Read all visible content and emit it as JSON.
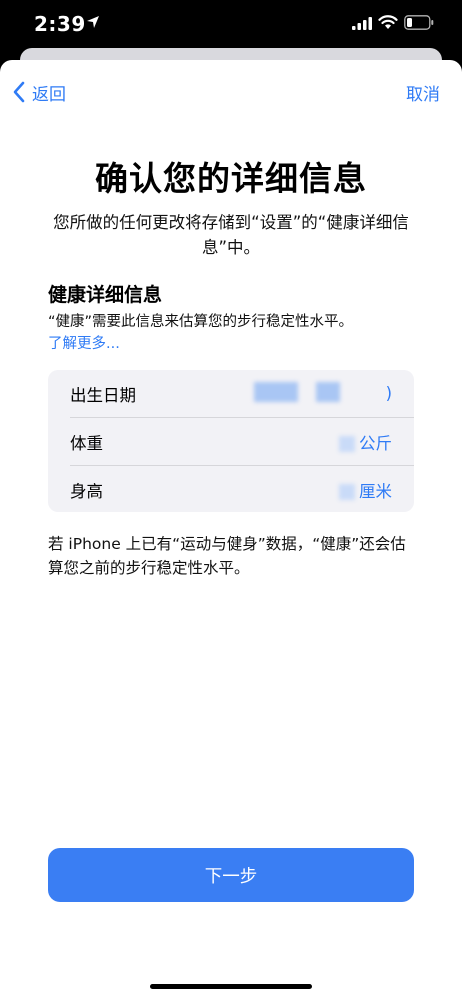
{
  "status_bar": {
    "time": "2:39"
  },
  "nav": {
    "back_label": "返回",
    "cancel_label": "取消"
  },
  "title": "确认您的详细信息",
  "subtitle": "您所做的任何更改将存储到“设置”的“健康详细信息”中。",
  "section": {
    "title": "健康详细信息",
    "description": "“健康”需要此信息来估算您的步行稳定性水平。",
    "learn_more": "了解更多..."
  },
  "fields": [
    {
      "label": "出生日期",
      "value": ")"
    },
    {
      "label": "体重",
      "value": "公斤"
    },
    {
      "label": "身高",
      "value": "厘米"
    }
  ],
  "footnote": "若 iPhone 上已有“运动与健身”数据，“健康”还会估算您之前的步行稳定性水平。",
  "next_button": "下一步",
  "colors": {
    "accent": "#2f7bf5",
    "button": "#3a7ef3",
    "card": "#f2f2f6"
  }
}
